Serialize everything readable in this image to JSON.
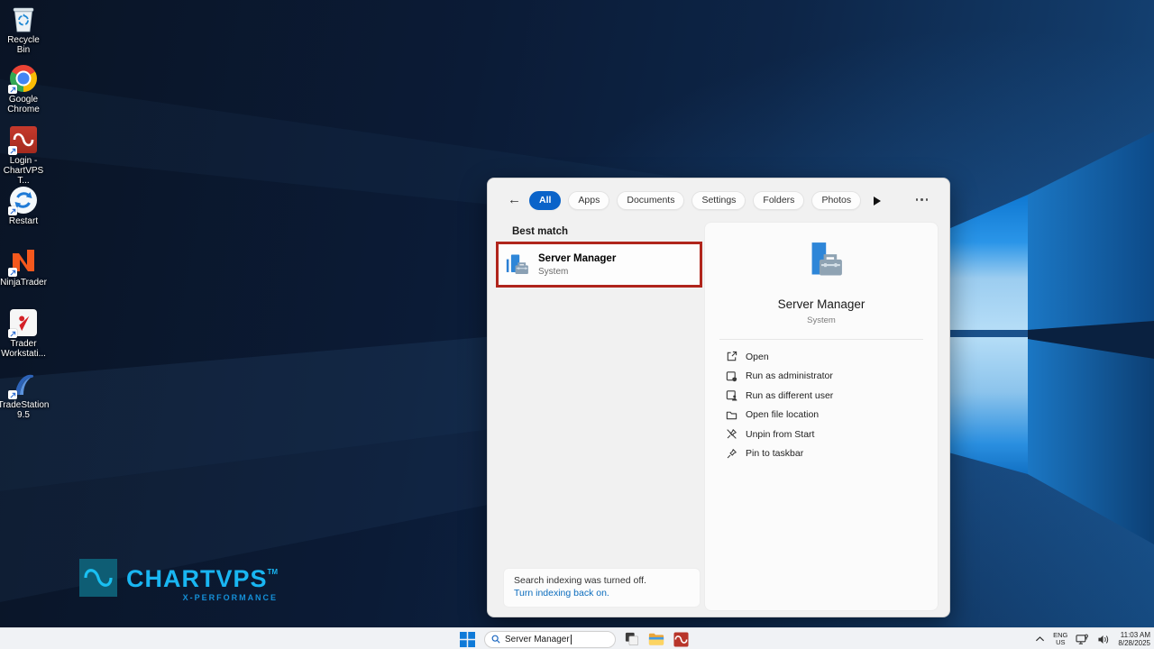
{
  "desktop": {
    "icons": [
      {
        "label1": "Recycle Bin",
        "label2": ""
      },
      {
        "label1": "Google",
        "label2": "Chrome"
      },
      {
        "label1": "Login -",
        "label2": "ChartVPS T..."
      },
      {
        "label1": "Restart",
        "label2": ""
      },
      {
        "label1": "NinjaTrader",
        "label2": ""
      },
      {
        "label1": "Trader",
        "label2": "Workstati..."
      },
      {
        "label1": "TradeStation",
        "label2": "9.5"
      }
    ],
    "brand": {
      "name": "CHARTVPS",
      "tm": "TM",
      "tagline": "X-PERFORMANCE"
    }
  },
  "search_panel": {
    "tabs": {
      "all": "All",
      "apps": "Apps",
      "documents": "Documents",
      "settings": "Settings",
      "folders": "Folders",
      "photos": "Photos"
    },
    "section_title": "Best match",
    "best_match": {
      "title": "Server Manager",
      "subtitle": "System"
    },
    "notice": {
      "line1": "Search indexing was turned off.",
      "link": "Turn indexing back on."
    },
    "preview": {
      "title": "Server Manager",
      "subtitle": "System",
      "actions": [
        {
          "label": "Open"
        },
        {
          "label": "Run as administrator"
        },
        {
          "label": "Run as different user"
        },
        {
          "label": "Open file location"
        },
        {
          "label": "Unpin from Start"
        },
        {
          "label": "Pin to taskbar"
        }
      ]
    }
  },
  "taskbar": {
    "search": {
      "value": "Server Manager"
    },
    "tray": {
      "lang_top": "ENG",
      "lang_bottom": "US",
      "time": "11:03 AM",
      "date": "8/28/2025"
    }
  },
  "colors": {
    "accent_blue": "#0a63c9",
    "annotation_red": "#b0251c",
    "link_blue": "#0b6cbd",
    "server_icon_blue": "#2e86d8",
    "toolbox_gray": "#8aa0b4"
  }
}
